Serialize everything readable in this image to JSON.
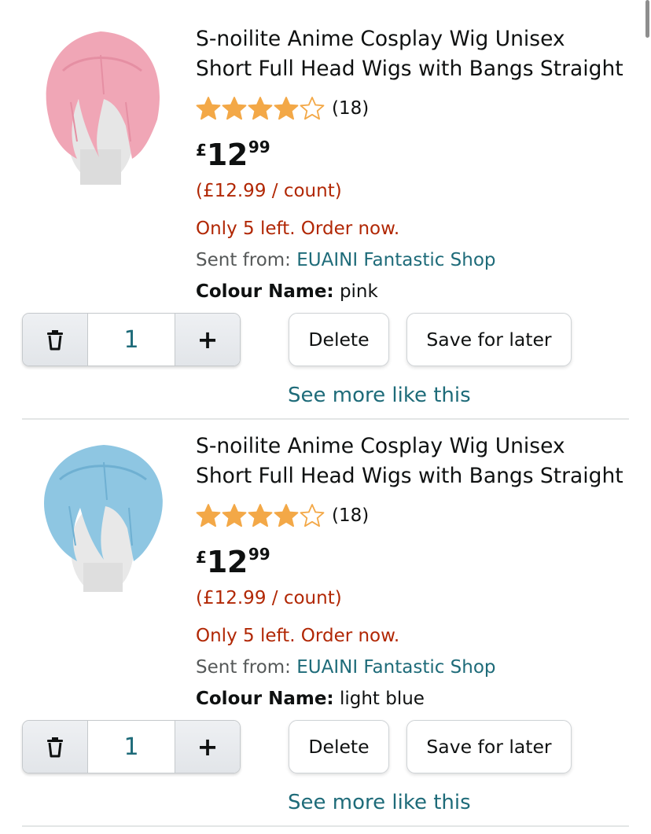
{
  "cart": {
    "items": [
      {
        "title_line1": "S-noilite Anime Cosplay Wig Unisex",
        "title_line2": "Short Full Head Wigs with Bangs Straight",
        "rating": 4.0,
        "rating_count": "(18)",
        "price": {
          "currency": "£",
          "whole": "12",
          "fraction": "99"
        },
        "unit_price": "(£12.99 / count)",
        "stock": "Only 5 left. Order now.",
        "sent_from_label": "Sent from:",
        "seller": "EUAINI Fantastic Shop",
        "colour_label": "Colour Name:",
        "colour_value": "pink",
        "quantity": "1",
        "delete_label": "Delete",
        "save_label": "Save for later",
        "see_more_label": "See more like this",
        "hair_color": "#f0a6b6"
      },
      {
        "title_line1": "S-noilite Anime Cosplay Wig Unisex",
        "title_line2": "Short Full Head Wigs with Bangs Straight",
        "rating": 4.0,
        "rating_count": "(18)",
        "price": {
          "currency": "£",
          "whole": "12",
          "fraction": "99"
        },
        "unit_price": "(£12.99 / count)",
        "stock": "Only 5 left. Order now.",
        "sent_from_label": "Sent from:",
        "seller": "EUAINI Fantastic Shop",
        "colour_label": "Colour Name:",
        "colour_value": "light blue",
        "quantity": "1",
        "delete_label": "Delete",
        "save_label": "Save for later",
        "see_more_label": "See more like this",
        "hair_color": "#8ec6e2"
      }
    ]
  },
  "colors": {
    "star": "#f3a847",
    "link": "#1e6b79",
    "alert": "#b12704"
  },
  "icons": {
    "delete": "trash-icon",
    "add": "plus-icon",
    "rating": "star-icon"
  }
}
